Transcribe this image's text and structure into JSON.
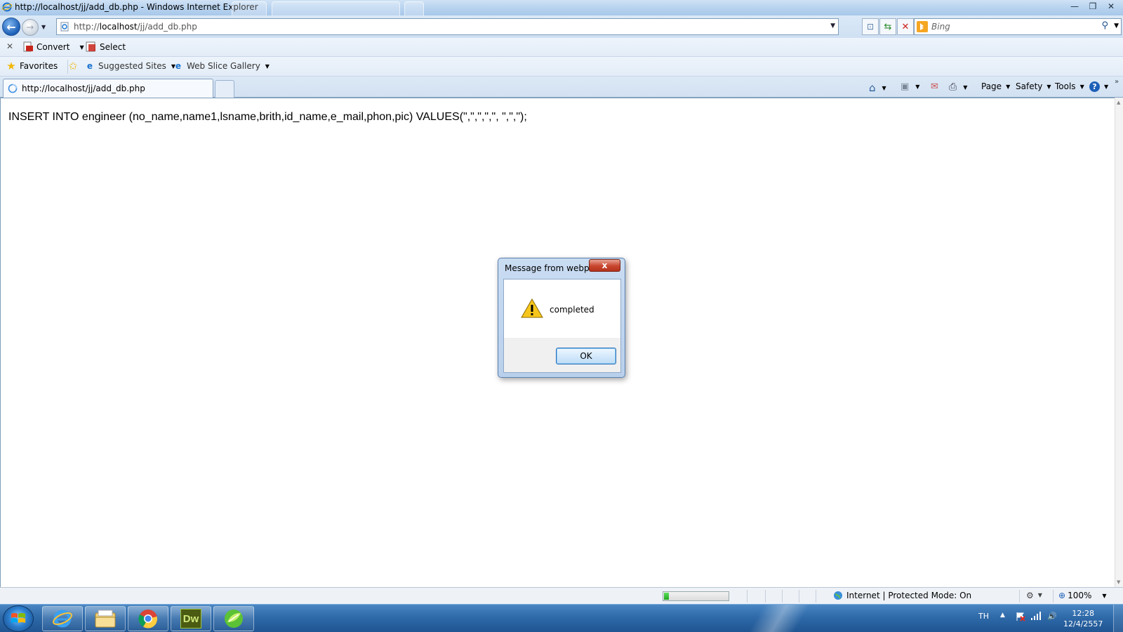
{
  "window": {
    "title": "http://localhost/jj/add_db.php - Windows Internet Explorer",
    "controls": {
      "minimize": "—",
      "restore": "❐",
      "close": "✕"
    }
  },
  "navigation": {
    "back_icon": "back-arrow-icon",
    "forward_icon": "forward-arrow-icon",
    "address": {
      "prefix": "http://",
      "host": "localhost",
      "path": "/jj/add_db.php"
    },
    "search": {
      "placeholder": "Bing"
    }
  },
  "toolbar1": {
    "close_glyph": "✕",
    "convert_label": "Convert",
    "select_label": "Select"
  },
  "favorites_bar": {
    "favorites_label": "Favorites",
    "suggested_sites_label": "Suggested Sites",
    "web_slice_label": "Web Slice Gallery"
  },
  "tabs": {
    "active_label": "http://localhost/jj/add_db.php"
  },
  "command_bar": {
    "page_label": "Page",
    "safety_label": "Safety",
    "tools_label": "Tools"
  },
  "content": {
    "sql_text": "INSERT INTO engineer (no_name,name1,lsname,brith,id_name,e_mail,phon,pic) VALUES(\",\",\",\",\", \",\",\");"
  },
  "dialog": {
    "title": "Message from webp...",
    "message": "completed",
    "ok_label": "OK",
    "close_glyph": "x"
  },
  "status_bar": {
    "progress_fraction": 0.08,
    "zone_text": "Internet | Protected Mode: On",
    "zoom_text": "100%"
  },
  "taskbar": {
    "apps": [
      "internet-explorer",
      "windows-explorer",
      "google-chrome",
      "dreamweaver",
      "green-app"
    ],
    "dw_label": "Dw",
    "language": "TH",
    "time": "12:28",
    "date": "12/4/2557"
  },
  "colors": {
    "accent": "#1c5fb7",
    "dialog_close": "#c8462e",
    "progress": "#1fa81f",
    "taskbar": "#2f6aa9"
  }
}
